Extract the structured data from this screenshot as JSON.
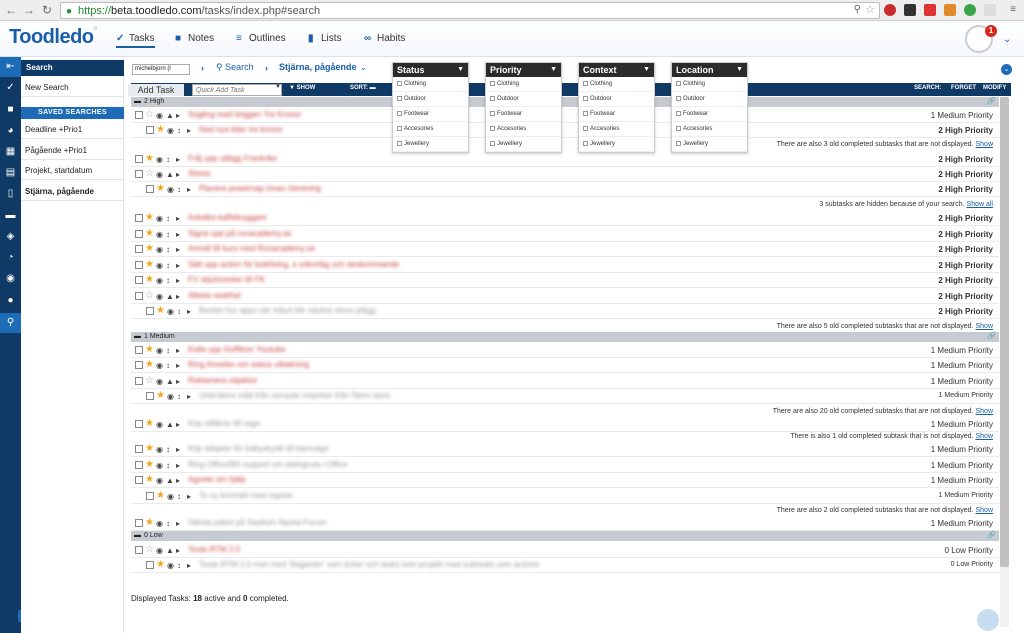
{
  "browser": {
    "url_scheme": "https://",
    "url_host": "beta.toodledo.com",
    "url_path": "/tasks/index.php#search"
  },
  "app": {
    "logo": "Toodledo",
    "nav": [
      {
        "label": "Tasks",
        "icon": "check-icon"
      },
      {
        "label": "Notes",
        "icon": "book-icon"
      },
      {
        "label": "Outlines",
        "icon": "outline-icon"
      },
      {
        "label": "Lists",
        "icon": "lists-icon"
      },
      {
        "label": "Habits",
        "icon": "habits-icon"
      }
    ],
    "notification_count": "1"
  },
  "sidebar": {
    "header": "Search",
    "new_search": "New Search",
    "saved_title": "SAVED SEARCHES",
    "saved": [
      "Deadline +Prio1",
      "Pågående +Prio1",
      "Projekt, startdatum",
      "Stjärna, pågående"
    ]
  },
  "crumbs": {
    "account": "michelbjorn (l",
    "search": "Search",
    "current": "Stjärna, pågående"
  },
  "toolbar": {
    "add_task": "Add Task",
    "quick_add_placeholder": "Quick Add Task",
    "show": "SHOW",
    "sort": "SORT:",
    "search": "SEARCH:",
    "forget": "FORGET",
    "modify": "MODIFY"
  },
  "dropdowns": [
    {
      "title": "Status",
      "items": [
        "Clothing",
        "Outdoor",
        "Footwear",
        "Accesories",
        "Jewellery"
      ]
    },
    {
      "title": "Priority",
      "items": [
        "Clothing",
        "Outdoor",
        "Footwear",
        "Accesories",
        "Jewellery"
      ]
    },
    {
      "title": "Context",
      "items": [
        "Clothing",
        "Outdoor",
        "Footwear",
        "Accesories",
        "Jewellery"
      ]
    },
    {
      "title": "Location",
      "items": [
        "Clothing",
        "Outdoor",
        "Footwear",
        "Accesories",
        "Jewellery"
      ]
    }
  ],
  "groups": [
    {
      "label": "2 High"
    },
    {
      "label": "1 Medium"
    },
    {
      "label": "0 Low"
    }
  ],
  "tasks": [
    {
      "title": "Sogling med briggen Tre Kronor",
      "priority": "1 Medium Priority"
    },
    {
      "title": "Ned nya tider tre kronor",
      "priority": "2 High Priority"
    },
    {
      "title": "Fråj upp utlägg Frankrike",
      "priority": "2 High Priority"
    },
    {
      "title": "Stress",
      "priority": "2 High Priority"
    },
    {
      "title": "Planera powernap innan hämtning",
      "priority": "2 High Priority"
    },
    {
      "title": "Avkalka kaffebryggare",
      "priority": "2 High Priority"
    },
    {
      "title": "Signa upp på runacademy.se",
      "priority": "2 High Priority"
    },
    {
      "title": "Anmäl till kurs med Runacademy.se",
      "priority": "2 High Priority"
    },
    {
      "title": "Sätt upp action för bokföring, e sökorläg och deskommande",
      "priority": "2 High Priority"
    },
    {
      "title": "FV skjutsreslan till FK",
      "priority": "2 High Priority"
    },
    {
      "title": "Albeta vaskfod",
      "priority": "2 High Priority"
    },
    {
      "title": "Beslän hur apps när måsrt blir nästnä sköra plägg",
      "priority": "2 High Priority"
    },
    {
      "title": "Kolla upp Gofftiner Youtube",
      "priority": "1 Medium Priority"
    },
    {
      "title": "Ring Anselan om status utbakning",
      "priority": "1 Medium Priority"
    },
    {
      "title": "Reklamera objektor",
      "priority": "1 Medium Priority"
    },
    {
      "title": "Utskrälera mått från senaste möjerker från Tahm store",
      "priority": "1 Medium Priority"
    },
    {
      "title": "Köp stålkniv till vagn",
      "priority": "1 Medium Priority"
    },
    {
      "title": "Köp adapter för babyskydd till barnvagn",
      "priority": "1 Medium Priority"
    },
    {
      "title": "Ring Office365 support om dialogruta i Office",
      "priority": "1 Medium Priority"
    },
    {
      "title": "Agnete om hjälp",
      "priority": "1 Medium Priority"
    },
    {
      "title": "To ny kontrakt med logrets",
      "priority": "1 Medium Priority"
    },
    {
      "title": "Hämta paket på Stadium Nacka Forum",
      "priority": "1 Medium Priority"
    },
    {
      "title": "Testa RTM 2.0",
      "priority": "0 Low Priority"
    },
    {
      "title": "Testa RTM 2.0 men med 'Bagarder' som ticker och tasks som projekt med subtasks som actions",
      "priority": "0 Low Priority"
    }
  ],
  "notes": [
    {
      "text": "There are also 3 old completed subtasks that are not displayed.",
      "link": "Show"
    },
    {
      "text": "3 subtasks are hidden because of your search.",
      "link": "Show all"
    },
    {
      "text": "There are also 5 old completed subtasks that are not displayed.",
      "link": "Show"
    },
    {
      "text": "There are also 20 old completed subtasks that are not displayed.",
      "link": "Show"
    },
    {
      "text": "There is also 1 old completed subtask that is not displayed.",
      "link": "Show"
    },
    {
      "text": "There are also 2 old completed subtasks that are not displayed.",
      "link": "Show"
    }
  ],
  "footer": {
    "prefix": "Displayed Tasks: ",
    "active": "18",
    "mid": " active and ",
    "completed": "0",
    "suffix": " completed."
  }
}
